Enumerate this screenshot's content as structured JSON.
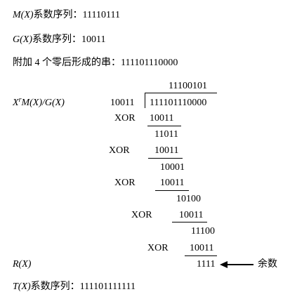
{
  "m_line": {
    "sym": "M(X)",
    "rest": "系数序列：11110111"
  },
  "g_line": {
    "sym": "G(X)",
    "rest": "系数序列：10011"
  },
  "append_line": "附加 4 个零后形成的串：111101110000",
  "division": {
    "lhs_a": "X",
    "lhs_sup": "r",
    "lhs_b": "M(X)/G(X)",
    "quotient": "11100101",
    "divisor": "10011",
    "dividend": "111101110000",
    "steps": [
      {
        "op": "XOR",
        "subtrahend": "10011",
        "result": "11011"
      },
      {
        "op": "XOR",
        "subtrahend": "10011",
        "result": "10001"
      },
      {
        "op": "XOR",
        "subtrahend": "10011",
        "result": "10100"
      },
      {
        "op": "XOR",
        "subtrahend": "10011",
        "result": "11100"
      },
      {
        "op": "XOR",
        "subtrahend": "10011",
        "result": "1111"
      }
    ]
  },
  "remainder": {
    "sym": "R(X)",
    "annotation": "余数"
  },
  "t_line": {
    "sym": "T(X)",
    "rest": "系数序列：111101111111"
  }
}
